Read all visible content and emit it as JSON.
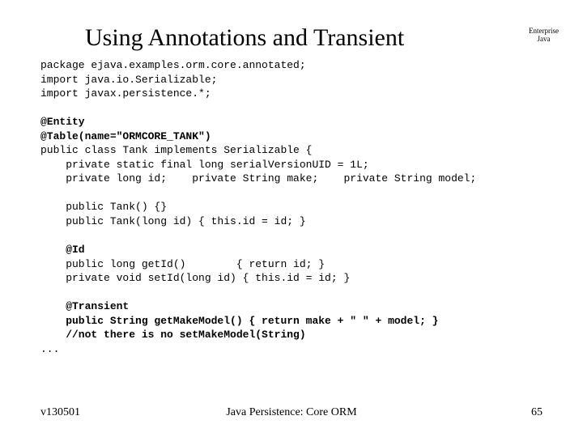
{
  "title": "Using Annotations and Transient",
  "corner_line1": "Enterprise",
  "corner_line2": "Java",
  "code": {
    "l1": "package ejava.examples.orm.core.annotated;",
    "l2": "import java.io.Serializable;",
    "l3": "import javax.persistence.*;",
    "l4": "",
    "l5": "@Entity",
    "l6": "@Table(name=\"ORMCORE_TANK\")",
    "l7": "public class Tank implements Serializable {",
    "l8": "    private static final long serialVersionUID = 1L;",
    "l9": "    private long id;    private String make;    private String model;",
    "l10": "",
    "l11": "    public Tank() {}",
    "l12": "    public Tank(long id) { this.id = id; }",
    "l13": "",
    "l14": "    @Id",
    "l15": "    public long getId()        { return id; }",
    "l16": "    private void setId(long id) { this.id = id; }",
    "l17": "",
    "l18": "    @Transient",
    "l19": "    public String getMakeModel() { return make + \" \" + model; }",
    "l20": "    //not there is no setMakeModel(String)",
    "l21": "..."
  },
  "footer": {
    "left": "v130501",
    "center": "Java Persistence: Core ORM",
    "right": "65"
  }
}
